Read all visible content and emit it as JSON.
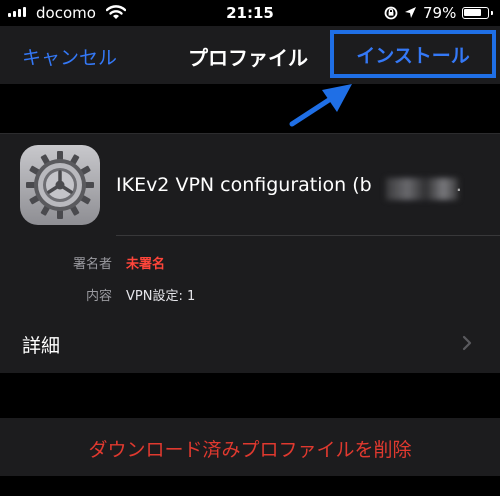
{
  "status_bar": {
    "carrier": "docomo",
    "time": "21:15",
    "battery_percent": "79%",
    "battery_level": 0.79,
    "icons": [
      "signal-bars-icon",
      "wifi-icon",
      "rotation-lock-icon",
      "location-arrow-icon",
      "battery-icon"
    ]
  },
  "nav": {
    "cancel_label": "キャンセル",
    "title": "プロファイル",
    "install_label": "インストール",
    "highlight_color": "#1f6fe6"
  },
  "profile": {
    "icon": "settings-gear-icon",
    "name": "IKEv2 VPN configuration (b",
    "name_suffix": "."
  },
  "signer": {
    "label": "署名者",
    "value": "未署名"
  },
  "contents": {
    "label": "内容",
    "value": "VPN設定: 1"
  },
  "details": {
    "label": "詳細"
  },
  "delete": {
    "label": "ダウンロード済みプロファイルを削除"
  },
  "colors": {
    "accent": "#3478f6",
    "destructive": "#e0392f"
  }
}
